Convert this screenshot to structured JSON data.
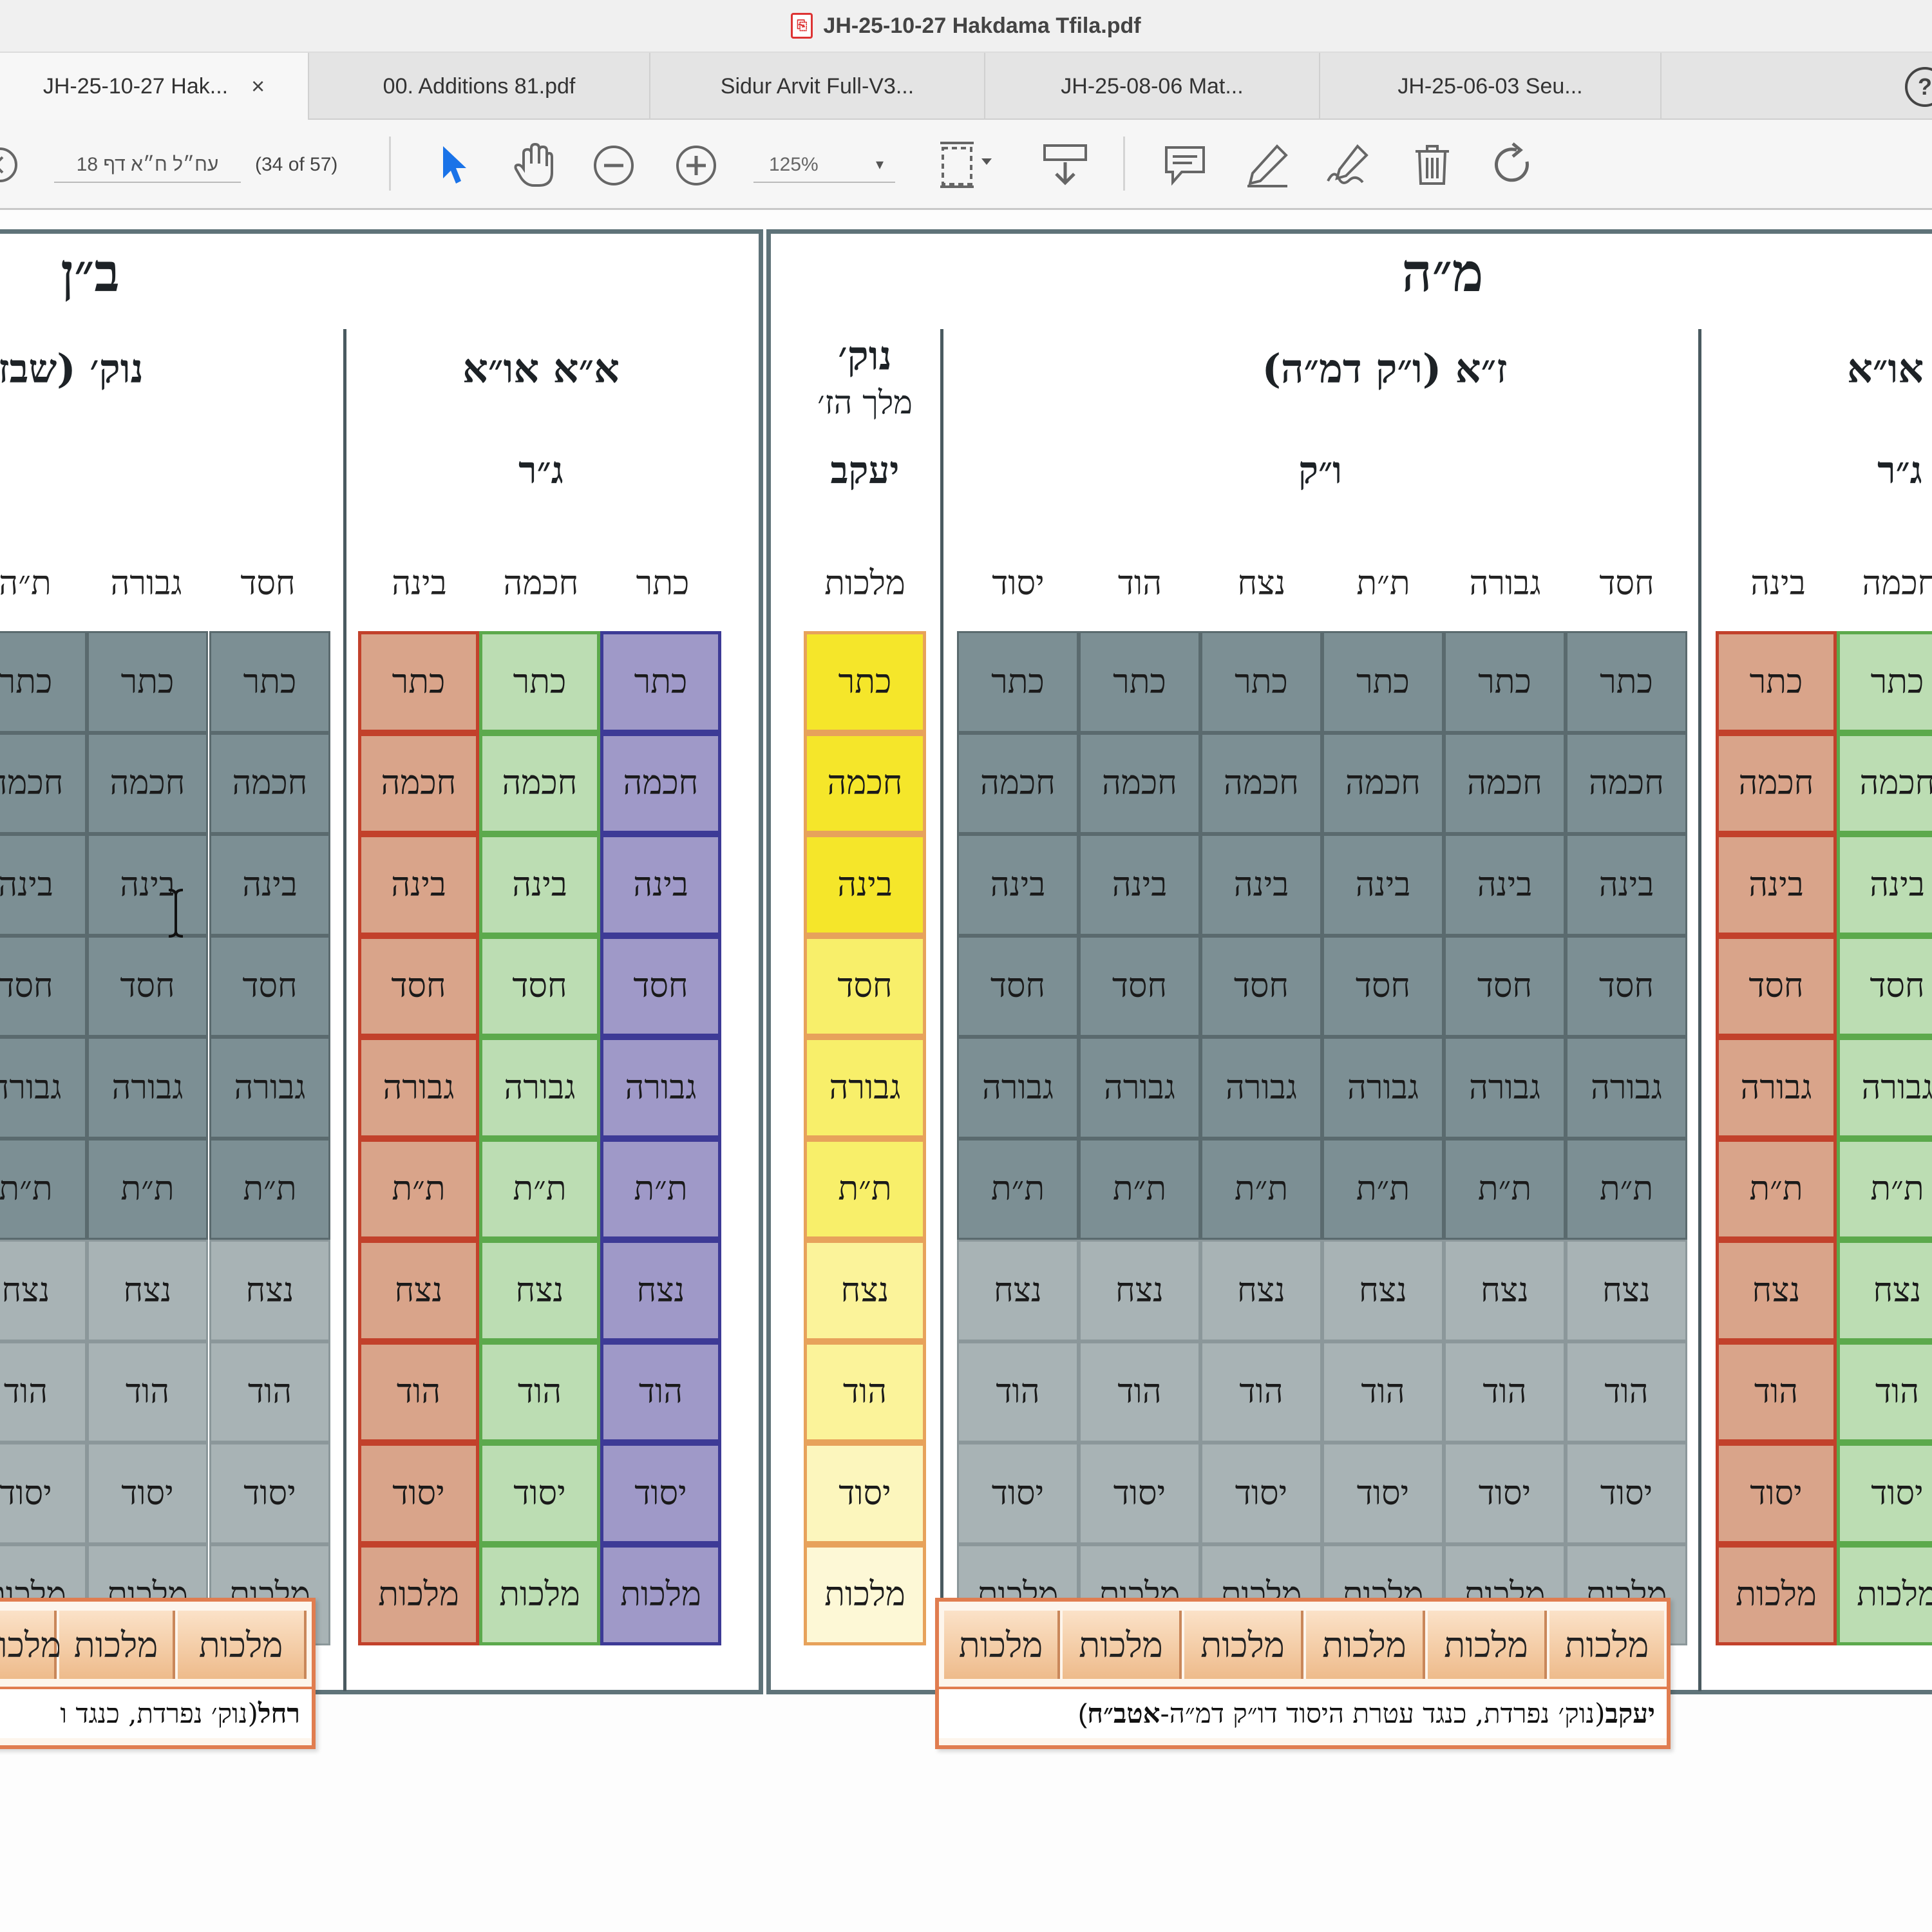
{
  "window": {
    "title": "JH-25-10-27 Hakdama Tfila.pdf"
  },
  "tabs": [
    {
      "label": "JH-25-10-27 Hak...",
      "close": "×",
      "active": true
    },
    {
      "label": "00. Additions 81.pdf"
    },
    {
      "label": "Sidur Arvit Full-V3..."
    },
    {
      "label": "JH-25-08-06 Mat..."
    },
    {
      "label": "JH-25-06-03 Seu..."
    }
  ],
  "help": "?",
  "toolbar": {
    "page_label": "עח״ל ח״א דף 18",
    "page_count": "(34 of 57)",
    "zoom": "125%",
    "zoom_caret": "▾"
  },
  "colors": {
    "dark_cell": "#7c8f94",
    "light_cell": "#a8b3b5",
    "red": "#c2412b",
    "green": "#5ca94c",
    "blue": "#3d3a96",
    "yellow": "#f5e62a",
    "orange": "#e07d50",
    "cursor_blue": "#1a73e8"
  },
  "sefirot": [
    "כתר",
    "חכמה",
    "בינה",
    "חסד",
    "גבורה",
    "ת״ת",
    "נצח",
    "הוד",
    "יסוד",
    "מלכות"
  ],
  "doc": {
    "bn": {
      "title": "ב״ן",
      "nok_head": "נוק׳ (שבז",
      "aa_head": "א״א או״א",
      "aa_sub": "ג״ר",
      "nok_cols": [
        "ת״ה",
        "גבורה",
        "חסד"
      ],
      "aa_cols": [
        "בינה",
        "חכמה",
        "כתר"
      ],
      "strip_malchut": [
        "מלכות",
        "מלכות",
        "מלכות"
      ],
      "caption_bold": "רחל",
      "caption_rest": " (נוק׳ נפרדת, כנגד ו"
    },
    "mh": {
      "title": "מ״ה",
      "nok_head": "נוק׳",
      "nok_sub": "מלך הז׳",
      "nok_name": "יעקב",
      "nok_col": "מלכות",
      "za_head": "ז״א (ו״ק דמ״ה)",
      "za_sub": "ו״ק",
      "za_cols": [
        "יסוד",
        "הוד",
        "נצח",
        "ת״ת",
        "גבורה",
        "חסד"
      ],
      "aa_head": "א״א או״א",
      "aa_sub": "ג״ר",
      "aa_cols": [
        "בינה",
        "חכמה"
      ],
      "strip_malchut": [
        "מלכות",
        "מלכות",
        "מלכות",
        "מלכות",
        "מלכות",
        "מלכות"
      ],
      "caption_bold": "יעקב",
      "caption_rest": " (נוק׳ נפרדת, כנגד עטרת היסוד דו״ק דמ״ה-",
      "caption_bold2": "אטב״ח",
      "caption_end": ")"
    }
  }
}
